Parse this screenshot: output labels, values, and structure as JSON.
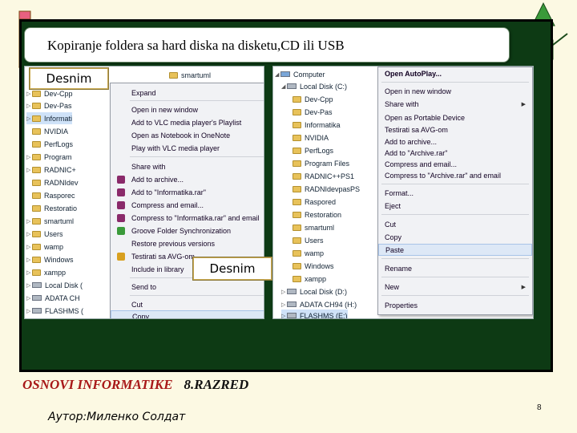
{
  "slide": {
    "title": "Kopiranje foldera sa hard diska na disketu,CD ili USB",
    "footer_title": "OSNOVI INFORMATIKE",
    "footer_grade": "8.RAZRED",
    "author": "Аутор:Миленко Солдат",
    "page_number": "8"
  },
  "labels": {
    "left": "Desnim",
    "center": "Desnim"
  },
  "left_explorer": {
    "top_folder": "smartuml",
    "tree": [
      {
        "name": "Dev-Cpp",
        "type": "folder"
      },
      {
        "name": "Dev-Pas",
        "type": "folder"
      },
      {
        "name": "Informati",
        "type": "folder"
      },
      {
        "name": "NVIDIA",
        "type": "folder"
      },
      {
        "name": "PerfLogs",
        "type": "folder"
      },
      {
        "name": "Program",
        "type": "folder"
      },
      {
        "name": "RADNIC+",
        "type": "folder"
      },
      {
        "name": "RADNIdev",
        "type": "folder"
      },
      {
        "name": "Rasporec",
        "type": "folder"
      },
      {
        "name": "Restoratio",
        "type": "folder"
      },
      {
        "name": "smartuml",
        "type": "folder"
      },
      {
        "name": "Users",
        "type": "folder"
      },
      {
        "name": "wamp",
        "type": "folder"
      },
      {
        "name": "Windows",
        "type": "folder"
      },
      {
        "name": "xampp",
        "type": "folder"
      },
      {
        "name": "Local Disk (",
        "type": "drive"
      },
      {
        "name": "ADATA CH",
        "type": "drive"
      },
      {
        "name": "FLASHMS (",
        "type": "drive"
      }
    ],
    "context_menu": [
      "Expand",
      "Open in new window",
      "Add to VLC media player's Playlist",
      "Open as Notebook in OneNote",
      "Play with VLC media player",
      "Share with",
      "Add to archive...",
      "Add to \"Informatika.rar\"",
      "Compress and email...",
      "Compress to \"Informatika.rar\" and email",
      "Groove Folder Synchronization",
      "Restore previous versions",
      "Testirati sa AVG-om",
      "Include in library",
      "Send to",
      "Cut",
      "Copy"
    ]
  },
  "right_explorer": {
    "tree": [
      {
        "name": "Computer",
        "type": "computer"
      },
      {
        "name": "Local Disk (C:)",
        "type": "drive"
      },
      {
        "name": "Dev-Cpp",
        "type": "folder"
      },
      {
        "name": "Dev-Pas",
        "type": "folder"
      },
      {
        "name": "Informatika",
        "type": "folder"
      },
      {
        "name": "NVIDIA",
        "type": "folder"
      },
      {
        "name": "PerfLogs",
        "type": "folder"
      },
      {
        "name": "Program Files",
        "type": "folder"
      },
      {
        "name": "RADNIC++PS1",
        "type": "folder"
      },
      {
        "name": "RADNIdevpasPS",
        "type": "folder"
      },
      {
        "name": "Raspored",
        "type": "folder"
      },
      {
        "name": "Restoration",
        "type": "folder"
      },
      {
        "name": "smartuml",
        "type": "folder"
      },
      {
        "name": "Users",
        "type": "folder"
      },
      {
        "name": "wamp",
        "type": "folder"
      },
      {
        "name": "Windows",
        "type": "folder"
      },
      {
        "name": "xampp",
        "type": "folder"
      },
      {
        "name": "Local Disk (D:)",
        "type": "drive"
      },
      {
        "name": "ADATA CH94 (H:)",
        "type": "drive"
      },
      {
        "name": "FLASHMS (E:)",
        "type": "drive"
      }
    ],
    "context_menu": [
      "Open AutoPlay...",
      "Open in new window",
      "Share with",
      "Open as Portable Device",
      "Testirati sa AVG-om",
      "Add to archive...",
      "Add to \"Archive.rar\"",
      "Compress and email...",
      "Compress to \"Archive.rar\" and email",
      "Format...",
      "Eject",
      "Cut",
      "Copy",
      "Paste",
      "Rename",
      "New",
      "Properties"
    ]
  },
  "colors": {
    "slide_bg": "#fcf9e3",
    "frame_bg": "#0d3a14",
    "footer_red": "#a81818",
    "folder": "#e8c25a"
  }
}
